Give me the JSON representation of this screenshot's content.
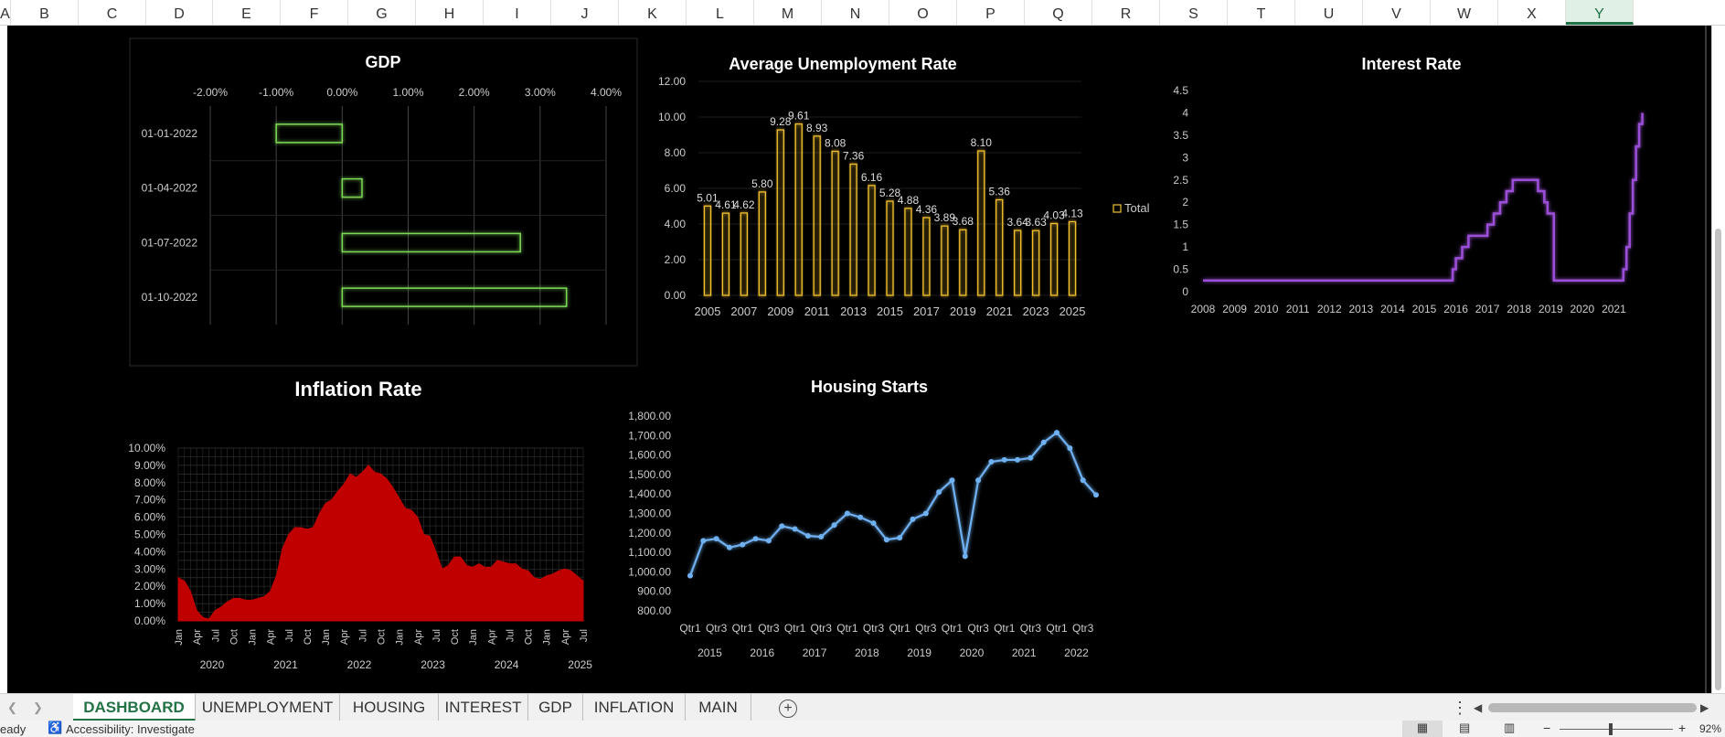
{
  "columns": [
    "A",
    "B",
    "C",
    "D",
    "E",
    "F",
    "G",
    "H",
    "I",
    "J",
    "K",
    "L",
    "M",
    "N",
    "O",
    "P",
    "Q",
    "R",
    "S",
    "T",
    "U",
    "V",
    "W",
    "X",
    "Y"
  ],
  "active_column": "Y",
  "sheets": {
    "tabs": [
      "DASHBOARD",
      "UNEMPLOYMENT",
      "HOUSING",
      "INTEREST",
      "GDP",
      "INFLATION",
      "MAIN"
    ],
    "active": "DASHBOARD"
  },
  "status": {
    "ready": "eady",
    "accessibility": "Accessibility: Investigate",
    "zoom": "92%"
  },
  "colors": {
    "gdp": "#7ed957",
    "unemployment": "#f2c12e",
    "interest": "#9b4fd8",
    "inflation": "#c00000",
    "housing": "#6fb0f0"
  },
  "chart_data": [
    {
      "id": "gdp",
      "type": "bar",
      "orientation": "horizontal",
      "title": "GDP",
      "categories": [
        "01-01-2022",
        "01-04-2022",
        "01-07-2022",
        "01-10-2022"
      ],
      "values": [
        -0.01,
        0.003,
        0.027,
        0.034
      ],
      "xlim": [
        -0.02,
        0.04
      ],
      "xticks": [
        "-2.00%",
        "-1.00%",
        "0.00%",
        "1.00%",
        "2.00%",
        "3.00%",
        "4.00%"
      ]
    },
    {
      "id": "unemployment",
      "type": "bar",
      "title": "Average Unemployment Rate",
      "categories": [
        "2005",
        "2006",
        "2007",
        "2008",
        "2009",
        "2010",
        "2011",
        "2012",
        "2013",
        "2014",
        "2015",
        "2016",
        "2017",
        "2018",
        "2019",
        "2020",
        "2021",
        "2022",
        "2023",
        "2024",
        "2025"
      ],
      "values": [
        5.01,
        4.61,
        4.62,
        5.8,
        9.28,
        9.61,
        8.93,
        8.08,
        7.36,
        6.16,
        5.28,
        4.88,
        4.36,
        3.89,
        3.68,
        8.1,
        5.36,
        3.64,
        3.63,
        4.03,
        4.13
      ],
      "labels": [
        "5.01",
        "4.61",
        "4.62",
        "5.80",
        "9.28",
        "9.61",
        "8.93",
        "8.08",
        "7.36",
        "6.16",
        "5.28",
        "4.88",
        "4.36",
        "3.89",
        "3.68",
        "8.10",
        "5.36",
        "3.64",
        "3.63",
        "4.03",
        "4.13"
      ],
      "xticks": [
        "2005",
        "2007",
        "2009",
        "2011",
        "2013",
        "2015",
        "2017",
        "2019",
        "2021",
        "2023",
        "2025"
      ],
      "yticks": [
        "0.00",
        "2.00",
        "4.00",
        "6.00",
        "8.00",
        "10.00",
        "12.00"
      ],
      "ylim": [
        0,
        12
      ],
      "legend": "Total"
    },
    {
      "id": "interest",
      "type": "line",
      "step": true,
      "title": "Interest Rate",
      "x": [
        2008.0,
        2015.0,
        2015.9,
        2016.0,
        2016.2,
        2016.4,
        2016.8,
        2017.0,
        2017.2,
        2017.4,
        2017.6,
        2017.8,
        2018.0,
        2018.6,
        2018.8,
        2018.9,
        2019.0,
        2019.1,
        2019.3,
        2021.2,
        2021.3,
        2021.4,
        2021.5,
        2021.6,
        2021.7,
        2021.8,
        2021.9
      ],
      "y": [
        0.25,
        0.25,
        0.5,
        0.75,
        1.0,
        1.25,
        1.25,
        1.5,
        1.75,
        2.0,
        2.25,
        2.5,
        2.5,
        2.25,
        2.0,
        1.75,
        1.75,
        0.25,
        0.25,
        0.25,
        0.5,
        1.0,
        1.75,
        2.5,
        3.25,
        3.75,
        4.0
      ],
      "xlim": [
        2008,
        2022.0
      ],
      "ylim": [
        0,
        4.5
      ],
      "xticks": [
        "2008",
        "2009",
        "2010",
        "2011",
        "2012",
        "2013",
        "2014",
        "2015",
        "2016",
        "2017",
        "2018",
        "2019",
        "2020",
        "2021"
      ],
      "yticks": [
        "0",
        "0.5",
        "1",
        "1.5",
        "2",
        "2.5",
        "3",
        "3.5",
        "4",
        "4.5"
      ]
    },
    {
      "id": "inflation",
      "type": "area",
      "title": "Inflation Rate",
      "values": [
        2.5,
        2.3,
        1.7,
        0.6,
        0.2,
        0.1,
        0.6,
        0.8,
        1.1,
        1.3,
        1.3,
        1.2,
        1.2,
        1.3,
        1.4,
        1.7,
        2.6,
        4.2,
        5.0,
        5.4,
        5.4,
        5.3,
        5.4,
        6.2,
        6.8,
        7.0,
        7.5,
        7.9,
        8.5,
        8.3,
        8.6,
        9.0,
        8.6,
        8.5,
        8.2,
        7.7,
        7.1,
        6.5,
        6.4,
        6.0,
        5.0,
        4.9,
        4.0,
        3.0,
        3.2,
        3.7,
        3.7,
        3.2,
        3.1,
        3.3,
        3.1,
        3.1,
        3.5,
        3.4,
        3.3,
        3.3,
        3.0,
        2.9,
        2.5,
        2.4,
        2.6,
        2.7,
        2.9,
        3.0,
        2.9,
        2.6,
        2.3
      ],
      "ylim": [
        0,
        10
      ],
      "yticks": [
        "0.00%",
        "1.00%",
        "2.00%",
        "3.00%",
        "4.00%",
        "5.00%",
        "6.00%",
        "7.00%",
        "8.00%",
        "9.00%",
        "10.00%"
      ],
      "month_labels": [
        "Jan",
        "Apr",
        "Jul",
        "Oct"
      ],
      "years": [
        "2020",
        "2021",
        "2022",
        "2023",
        "2024",
        "2025"
      ]
    },
    {
      "id": "housing",
      "type": "line",
      "title": "Housing Starts",
      "values": [
        980,
        1160,
        1170,
        1125,
        1140,
        1170,
        1160,
        1235,
        1220,
        1185,
        1180,
        1240,
        1300,
        1280,
        1250,
        1165,
        1175,
        1270,
        1300,
        1410,
        1470,
        1080,
        1470,
        1565,
        1575,
        1575,
        1585,
        1665,
        1715,
        1635,
        1470,
        1395
      ],
      "ylim": [
        800,
        1800
      ],
      "yticks": [
        "800.00",
        "900.00",
        "1,000.00",
        "1,100.00",
        "1,200.00",
        "1,300.00",
        "1,400.00",
        "1,500.00",
        "1,600.00",
        "1,700.00",
        "1,800.00"
      ],
      "quarter_labels": [
        "Qtr1",
        "Qtr3"
      ],
      "years": [
        "2015",
        "2016",
        "2017",
        "2018",
        "2019",
        "2020",
        "2021",
        "2022"
      ]
    }
  ]
}
